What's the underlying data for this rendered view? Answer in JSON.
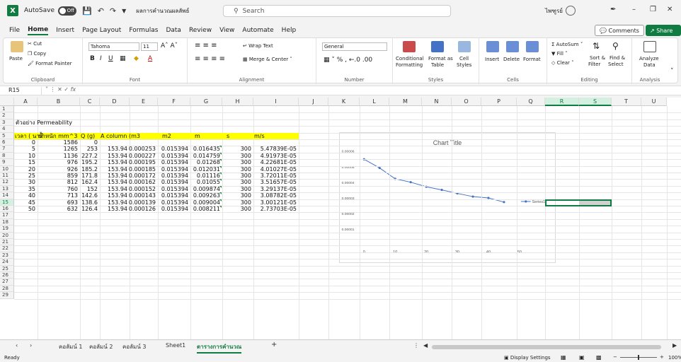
{
  "app": {
    "logo": "X",
    "autosave_label": "AutoSave",
    "autosave_state": "Off",
    "doc_name": "ผลการคำนวณผลลัพธ์",
    "search_placeholder": "Search",
    "user_name": "ไพฑูรย์"
  },
  "menu": {
    "items": [
      "File",
      "Home",
      "Insert",
      "Page Layout",
      "Formulas",
      "Data",
      "Review",
      "View",
      "Automate",
      "Help"
    ],
    "active": "Home",
    "comments_label": "Comments",
    "share_label": "Share"
  },
  "ribbon": {
    "clipboard": {
      "paste": "Paste",
      "cut": "Cut",
      "copy": "Copy",
      "format_painter": "Format Painter",
      "label": "Clipboard"
    },
    "font": {
      "name": "Tahoma",
      "size": "11",
      "label": "Font"
    },
    "alignment": {
      "wrap": "Wrap Text",
      "merge": "Merge & Center",
      "label": "Alignment"
    },
    "number": {
      "format": "General",
      "label": "Number"
    },
    "styles": {
      "conditional": "Conditional",
      "conditional2": "Formatting",
      "format_as": "Format as",
      "format_as2": "Table",
      "cell": "Cell",
      "cell2": "Styles",
      "label": "Styles"
    },
    "cells": {
      "insert": "Insert",
      "delete": "Delete",
      "format": "Format",
      "label": "Cells"
    },
    "editing": {
      "autosum": "AutoSum",
      "fill": "Fill",
      "clear": "Clear",
      "sort": "Sort &",
      "sort2": "Filter",
      "find": "Find &",
      "find2": "Select",
      "label": "Editing"
    },
    "analysis": {
      "analyze": "Analyze",
      "analyze2": "Data",
      "label": "Analysis"
    }
  },
  "formula_bar": {
    "name_box": "R15",
    "fx": "fx",
    "value": ""
  },
  "columns": [
    "A",
    "B",
    "C",
    "D",
    "E",
    "F",
    "G",
    "H",
    "I",
    "J",
    "K",
    "L",
    "M",
    "N",
    "O",
    "P",
    "Q",
    "R",
    "S",
    "T",
    "U"
  ],
  "rows": [
    "1",
    "2",
    "3",
    "4",
    "5",
    "6",
    "7",
    "8",
    "9",
    "10",
    "11",
    "12",
    "13",
    "14",
    "15",
    "16",
    "17",
    "18",
    "19",
    "20",
    "21",
    "22",
    "23",
    "24",
    "25",
    "26",
    "27",
    "28",
    "29"
  ],
  "sheet": {
    "title": "ตัวอย่าง Permeability",
    "headers": [
      "เวลา ( นาที",
      "น้ำหนัก mm^3",
      "Q (g)",
      "A column (m3",
      "m2",
      "m",
      "s",
      "m/s"
    ],
    "table": [
      [
        "0",
        "1586",
        "0",
        "",
        "",
        "",
        "",
        ""
      ],
      [
        "5",
        "1265",
        "253",
        "153.94",
        "0.000253",
        "0.015394",
        "0.016435",
        "300",
        "5.47839E-05"
      ],
      [
        "10",
        "1136",
        "227.2",
        "153.94",
        "0.000227",
        "0.015394",
        "0.014759",
        "300",
        "4.91973E-05"
      ],
      [
        "15",
        "976",
        "195.2",
        "153.94",
        "0.000195",
        "0.015394",
        "0.01268",
        "300",
        "4.22681E-05"
      ],
      [
        "20",
        "926",
        "185.2",
        "153.94",
        "0.000185",
        "0.015394",
        "0.012031",
        "300",
        "4.01027E-05"
      ],
      [
        "25",
        "859",
        "171.8",
        "153.94",
        "0.000172",
        "0.015394",
        "0.01116",
        "300",
        "3.72011E-05"
      ],
      [
        "30",
        "812",
        "162.4",
        "153.94",
        "0.000162",
        "0.015394",
        "0.01055",
        "300",
        "3.51657E-05"
      ],
      [
        "35",
        "760",
        "152",
        "153.94",
        "0.000152",
        "0.015394",
        "0.009874",
        "300",
        "3.29137E-05"
      ],
      [
        "40",
        "713",
        "142.6",
        "153.94",
        "0.000143",
        "0.015394",
        "0.009263",
        "300",
        "3.08782E-05"
      ],
      [
        "45",
        "693",
        "138.6",
        "153.94",
        "0.000139",
        "0.015394",
        "0.009004",
        "300",
        "3.00121E-05"
      ],
      [
        "50",
        "632",
        "126.4",
        "153.94",
        "0.000126",
        "0.015394",
        "0.008211",
        "300",
        "2.73703E-05"
      ]
    ]
  },
  "chart_data": {
    "type": "line",
    "title": "Chart Title",
    "x": [
      0,
      5,
      10,
      15,
      20,
      25,
      30,
      35,
      40,
      45
    ],
    "series": [
      {
        "name": "Series1",
        "values": [
          5.47839e-05,
          4.91973e-05,
          4.22681e-05,
          4.01027e-05,
          3.72011e-05,
          3.51657e-05,
          3.29137e-05,
          3.08782e-05,
          3.00121e-05,
          2.73703e-05
        ]
      }
    ],
    "xlim": [
      0,
      50
    ],
    "ylim": [
      0,
      6e-05
    ],
    "xticks": [
      "0",
      "10",
      "20",
      "30",
      "40",
      "50"
    ],
    "yticks": [
      "0.00001",
      "0.00002",
      "0.00003",
      "0.00004",
      "0.00005",
      "0.00006"
    ],
    "legend": "right",
    "grid": false,
    "line_color": "#4472c4"
  },
  "sheet_tabs": {
    "tabs": [
      "คอลัมน์ 1",
      "คอลัมน์ 2",
      "คอลัมน์ 3",
      "Sheet1",
      "ตารางการคำนวณ"
    ],
    "active": "ตารางการคำนวณ",
    "add": "+"
  },
  "status": {
    "ready": "Ready",
    "display_settings": "Display Settings",
    "zoom_minus": "−",
    "zoom_plus": "+",
    "zoom": "100%"
  }
}
